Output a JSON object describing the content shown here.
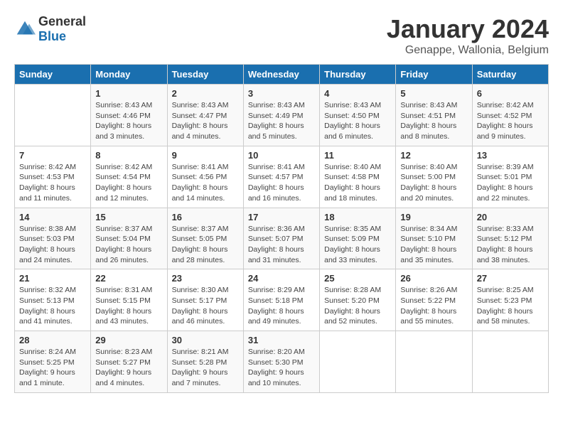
{
  "header": {
    "logo_general": "General",
    "logo_blue": "Blue",
    "main_title": "January 2024",
    "subtitle": "Genappe, Wallonia, Belgium"
  },
  "calendar": {
    "days_of_week": [
      "Sunday",
      "Monday",
      "Tuesday",
      "Wednesday",
      "Thursday",
      "Friday",
      "Saturday"
    ],
    "weeks": [
      [
        {
          "day": "",
          "info": ""
        },
        {
          "day": "1",
          "info": "Sunrise: 8:43 AM\nSunset: 4:46 PM\nDaylight: 8 hours\nand 3 minutes."
        },
        {
          "day": "2",
          "info": "Sunrise: 8:43 AM\nSunset: 4:47 PM\nDaylight: 8 hours\nand 4 minutes."
        },
        {
          "day": "3",
          "info": "Sunrise: 8:43 AM\nSunset: 4:49 PM\nDaylight: 8 hours\nand 5 minutes."
        },
        {
          "day": "4",
          "info": "Sunrise: 8:43 AM\nSunset: 4:50 PM\nDaylight: 8 hours\nand 6 minutes."
        },
        {
          "day": "5",
          "info": "Sunrise: 8:43 AM\nSunset: 4:51 PM\nDaylight: 8 hours\nand 8 minutes."
        },
        {
          "day": "6",
          "info": "Sunrise: 8:42 AM\nSunset: 4:52 PM\nDaylight: 8 hours\nand 9 minutes."
        }
      ],
      [
        {
          "day": "7",
          "info": "Sunrise: 8:42 AM\nSunset: 4:53 PM\nDaylight: 8 hours\nand 11 minutes."
        },
        {
          "day": "8",
          "info": "Sunrise: 8:42 AM\nSunset: 4:54 PM\nDaylight: 8 hours\nand 12 minutes."
        },
        {
          "day": "9",
          "info": "Sunrise: 8:41 AM\nSunset: 4:56 PM\nDaylight: 8 hours\nand 14 minutes."
        },
        {
          "day": "10",
          "info": "Sunrise: 8:41 AM\nSunset: 4:57 PM\nDaylight: 8 hours\nand 16 minutes."
        },
        {
          "day": "11",
          "info": "Sunrise: 8:40 AM\nSunset: 4:58 PM\nDaylight: 8 hours\nand 18 minutes."
        },
        {
          "day": "12",
          "info": "Sunrise: 8:40 AM\nSunset: 5:00 PM\nDaylight: 8 hours\nand 20 minutes."
        },
        {
          "day": "13",
          "info": "Sunrise: 8:39 AM\nSunset: 5:01 PM\nDaylight: 8 hours\nand 22 minutes."
        }
      ],
      [
        {
          "day": "14",
          "info": "Sunrise: 8:38 AM\nSunset: 5:03 PM\nDaylight: 8 hours\nand 24 minutes."
        },
        {
          "day": "15",
          "info": "Sunrise: 8:37 AM\nSunset: 5:04 PM\nDaylight: 8 hours\nand 26 minutes."
        },
        {
          "day": "16",
          "info": "Sunrise: 8:37 AM\nSunset: 5:05 PM\nDaylight: 8 hours\nand 28 minutes."
        },
        {
          "day": "17",
          "info": "Sunrise: 8:36 AM\nSunset: 5:07 PM\nDaylight: 8 hours\nand 31 minutes."
        },
        {
          "day": "18",
          "info": "Sunrise: 8:35 AM\nSunset: 5:09 PM\nDaylight: 8 hours\nand 33 minutes."
        },
        {
          "day": "19",
          "info": "Sunrise: 8:34 AM\nSunset: 5:10 PM\nDaylight: 8 hours\nand 35 minutes."
        },
        {
          "day": "20",
          "info": "Sunrise: 8:33 AM\nSunset: 5:12 PM\nDaylight: 8 hours\nand 38 minutes."
        }
      ],
      [
        {
          "day": "21",
          "info": "Sunrise: 8:32 AM\nSunset: 5:13 PM\nDaylight: 8 hours\nand 41 minutes."
        },
        {
          "day": "22",
          "info": "Sunrise: 8:31 AM\nSunset: 5:15 PM\nDaylight: 8 hours\nand 43 minutes."
        },
        {
          "day": "23",
          "info": "Sunrise: 8:30 AM\nSunset: 5:17 PM\nDaylight: 8 hours\nand 46 minutes."
        },
        {
          "day": "24",
          "info": "Sunrise: 8:29 AM\nSunset: 5:18 PM\nDaylight: 8 hours\nand 49 minutes."
        },
        {
          "day": "25",
          "info": "Sunrise: 8:28 AM\nSunset: 5:20 PM\nDaylight: 8 hours\nand 52 minutes."
        },
        {
          "day": "26",
          "info": "Sunrise: 8:26 AM\nSunset: 5:22 PM\nDaylight: 8 hours\nand 55 minutes."
        },
        {
          "day": "27",
          "info": "Sunrise: 8:25 AM\nSunset: 5:23 PM\nDaylight: 8 hours\nand 58 minutes."
        }
      ],
      [
        {
          "day": "28",
          "info": "Sunrise: 8:24 AM\nSunset: 5:25 PM\nDaylight: 9 hours\nand 1 minute."
        },
        {
          "day": "29",
          "info": "Sunrise: 8:23 AM\nSunset: 5:27 PM\nDaylight: 9 hours\nand 4 minutes."
        },
        {
          "day": "30",
          "info": "Sunrise: 8:21 AM\nSunset: 5:28 PM\nDaylight: 9 hours\nand 7 minutes."
        },
        {
          "day": "31",
          "info": "Sunrise: 8:20 AM\nSunset: 5:30 PM\nDaylight: 9 hours\nand 10 minutes."
        },
        {
          "day": "",
          "info": ""
        },
        {
          "day": "",
          "info": ""
        },
        {
          "day": "",
          "info": ""
        }
      ]
    ]
  }
}
